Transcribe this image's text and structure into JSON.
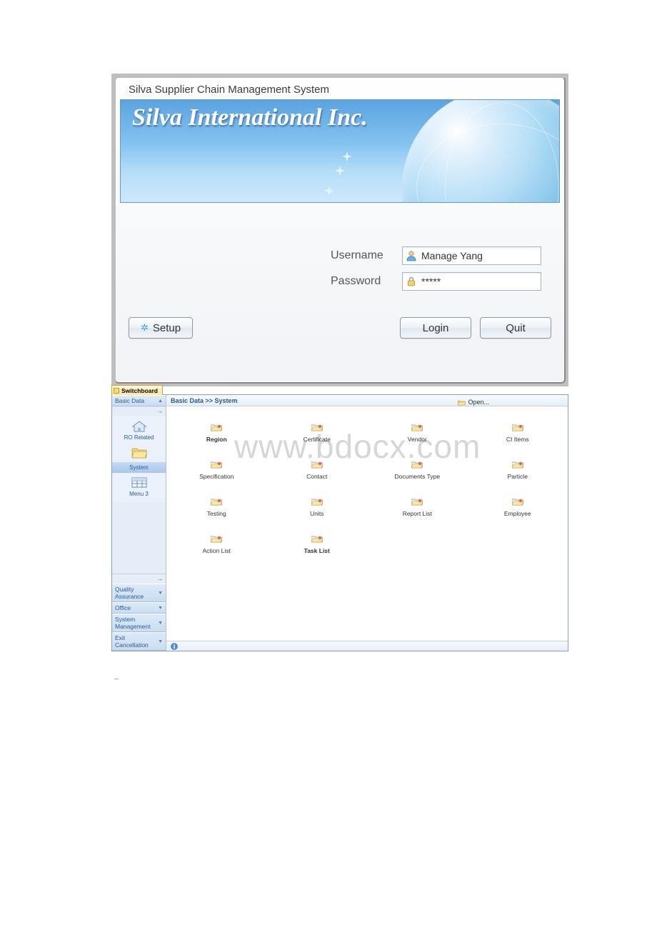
{
  "login": {
    "window_title": "Silva Supplier Chain Management System",
    "banner_text": "Silva International Inc.",
    "username_label": "Username",
    "password_label": "Password",
    "username_value": "Manage Yang",
    "password_value": "*****",
    "setup_label": "Setup",
    "login_label": "Login",
    "quit_label": "Quit"
  },
  "switchboard": {
    "tab_label": "Switchboard",
    "breadcrumb_left": "Basic Data",
    "breadcrumb_sep": " >> ",
    "breadcrumb_right": "System",
    "open_label": "Open...",
    "watermark": "www.bdocx.com",
    "sidebar": {
      "groups": {
        "basic_data": "Basic Data",
        "quality": "Quality Assurance",
        "office": "Office",
        "sysman": "System Management",
        "exit": "Exit Cancellation"
      },
      "items": {
        "ro_related": "RO Related",
        "system": "System",
        "menu3": "Menu 3"
      }
    },
    "tiles": [
      {
        "label": "Region",
        "bold": true
      },
      {
        "label": "Certificate",
        "bold": false
      },
      {
        "label": "Vendor",
        "bold": false
      },
      {
        "label": "CI Items",
        "bold": false
      },
      {
        "label": "Specification",
        "bold": false
      },
      {
        "label": "Contact",
        "bold": false
      },
      {
        "label": "Documents Type",
        "bold": false
      },
      {
        "label": "Particle",
        "bold": false
      },
      {
        "label": "Testing",
        "bold": false
      },
      {
        "label": "Units",
        "bold": false
      },
      {
        "label": "Report List",
        "bold": false
      },
      {
        "label": "Employee",
        "bold": false
      },
      {
        "label": "Action List",
        "bold": false
      },
      {
        "label": "Task List",
        "bold": true
      }
    ]
  }
}
